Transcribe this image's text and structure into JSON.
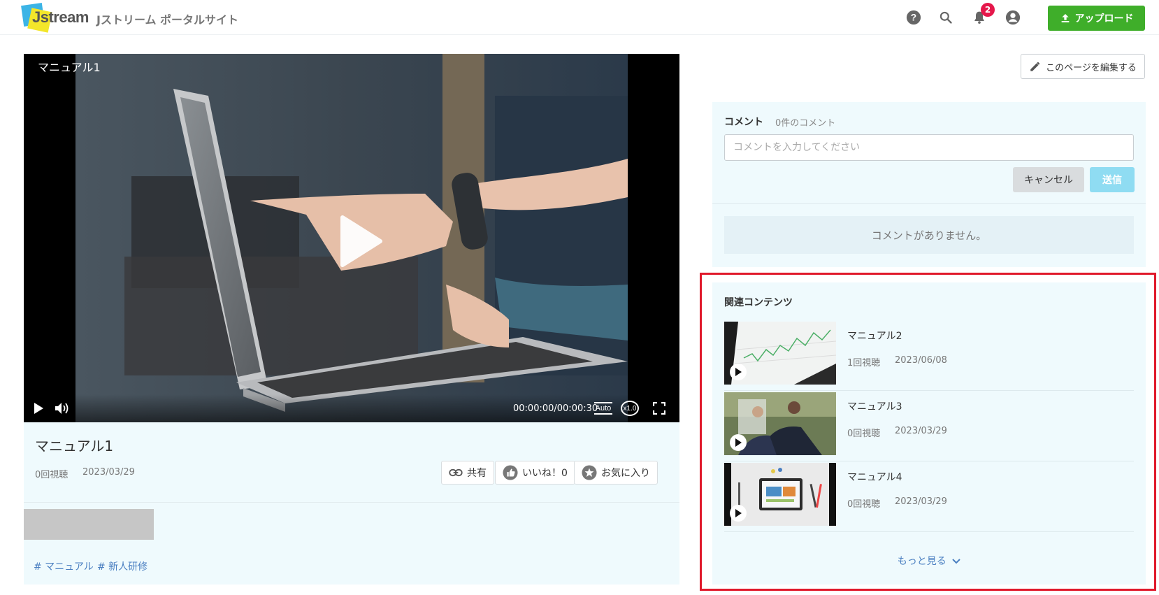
{
  "header": {
    "logo_text": "Jstream",
    "site_title": "Jストリーム ポータルサイト",
    "notification_count": "2",
    "upload_label": "アップロード"
  },
  "player": {
    "title": "マニュアル1",
    "time": "00:00:00/00:00:30",
    "quality": "Auto",
    "speed": "x1.0"
  },
  "video": {
    "title": "マニュアル1",
    "views": "0回視聴",
    "date": "2023/03/29",
    "share_label": "共有",
    "like_label": "いいね！0",
    "favorite_label": "お気に入り",
    "tags": [
      "# マニュアル",
      "# 新人研修"
    ]
  },
  "edit_page_label": "このページを編集する",
  "comments": {
    "heading": "コメント",
    "count": "0件のコメント",
    "placeholder": "コメントを入力してください",
    "cancel_label": "キャンセル",
    "send_label": "送信",
    "empty_message": "コメントがありません。"
  },
  "related": {
    "heading": "関連コンテンツ",
    "items": [
      {
        "title": "マニュアル2",
        "views": "1回視聴",
        "date": "2023/06/08"
      },
      {
        "title": "マニュアル3",
        "views": "0回視聴",
        "date": "2023/03/29"
      },
      {
        "title": "マニュアル4",
        "views": "0回視聴",
        "date": "2023/03/29"
      }
    ],
    "more_label": "もっと見る"
  },
  "colors": {
    "upload_green": "#3fae2a",
    "panel_bg": "#effafd",
    "highlight_red": "#e0192b",
    "link_blue": "#4a7fc1",
    "badge_pink": "#e5174b"
  }
}
